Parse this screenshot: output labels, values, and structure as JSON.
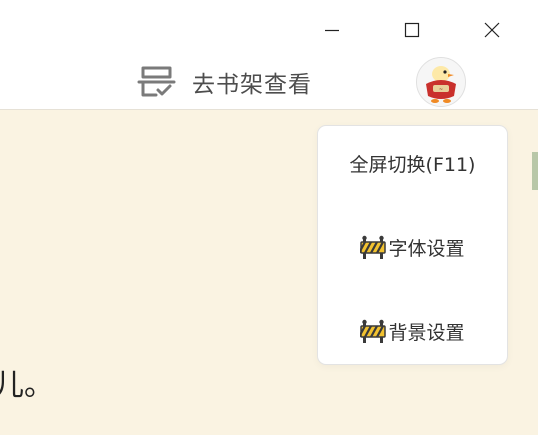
{
  "window": {
    "minimize_icon": "minimize-icon",
    "maximize_icon": "maximize-icon",
    "close_icon": "close-icon"
  },
  "header": {
    "shelf_label": "去书架查看",
    "shelf_icon": "bookshelf-icon",
    "avatar_icon": "duck-avatar"
  },
  "reader": {
    "text": "儿。"
  },
  "menu": {
    "items": [
      {
        "label": "全屏切换(F11)",
        "icon": ""
      },
      {
        "label": "字体设置",
        "icon": "barrier-icon"
      },
      {
        "label": "背景设置",
        "icon": "barrier-icon"
      }
    ]
  },
  "colors": {
    "reader_background": "#faf3e2",
    "menu_background": "#ffffff",
    "barrier_yellow": "#f2c230"
  }
}
